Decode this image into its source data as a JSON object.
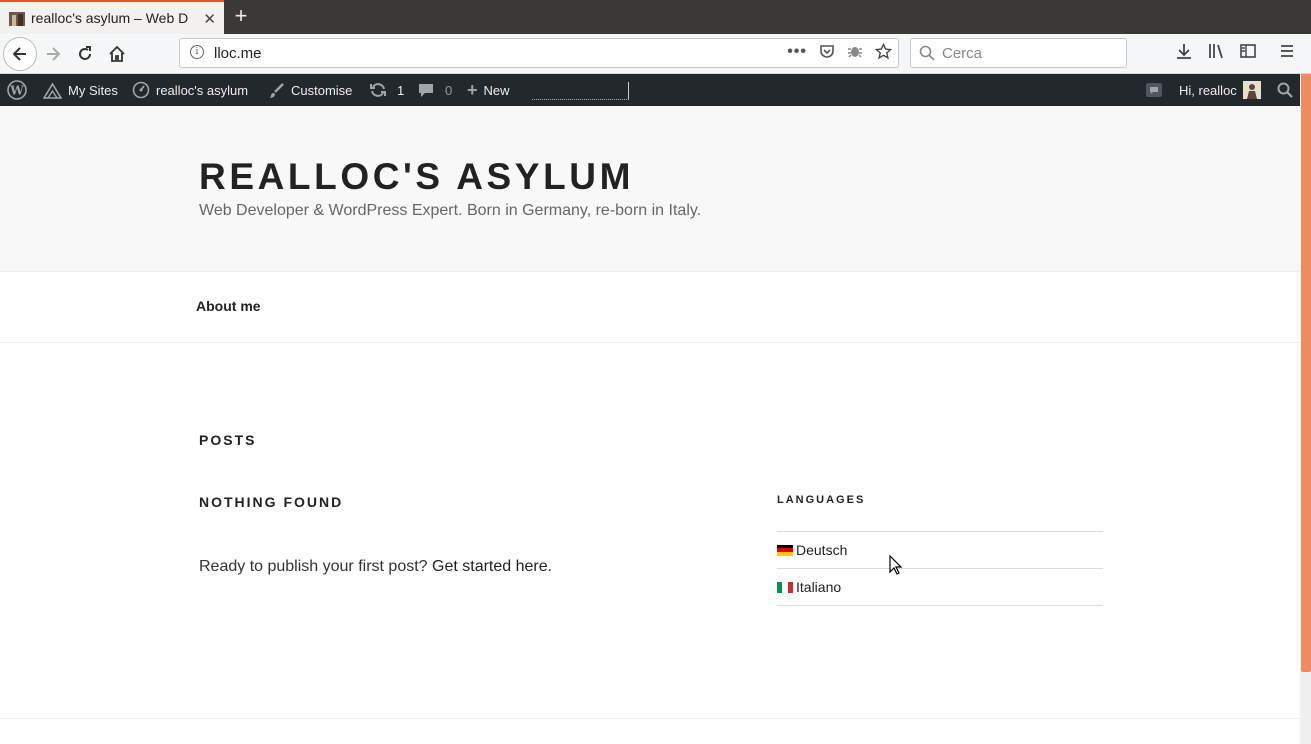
{
  "browser": {
    "tab_title": "realloc's asylum – Web D",
    "url": "lloc.me",
    "search_placeholder": "Cerca"
  },
  "adminbar": {
    "my_sites": "My Sites",
    "site_name": "realloc's asylum",
    "customise": "Customise",
    "updates_count": "1",
    "comments_count": "0",
    "new": "New",
    "greeting": "Hi, realloc"
  },
  "site": {
    "title": "REALLOC'S ASYLUM",
    "description": "Web Developer & WordPress Expert. Born in Germany, re-born in Italy.",
    "nav": {
      "about": "About me"
    }
  },
  "content": {
    "page_title": "POSTS",
    "nothing_found": "NOTHING FOUND",
    "publish_prefix": "Ready to publish your first post? ",
    "publish_link": "Get started here",
    "publish_suffix": "."
  },
  "widget": {
    "title": "LANGUAGES",
    "languages": [
      {
        "label": "Deutsch",
        "flag": "de"
      },
      {
        "label": "Italiano",
        "flag": "it"
      }
    ]
  },
  "colors": {
    "accent": "#e95420",
    "adminbar": "#23282d",
    "scroll_thumb": "#f08b61"
  }
}
